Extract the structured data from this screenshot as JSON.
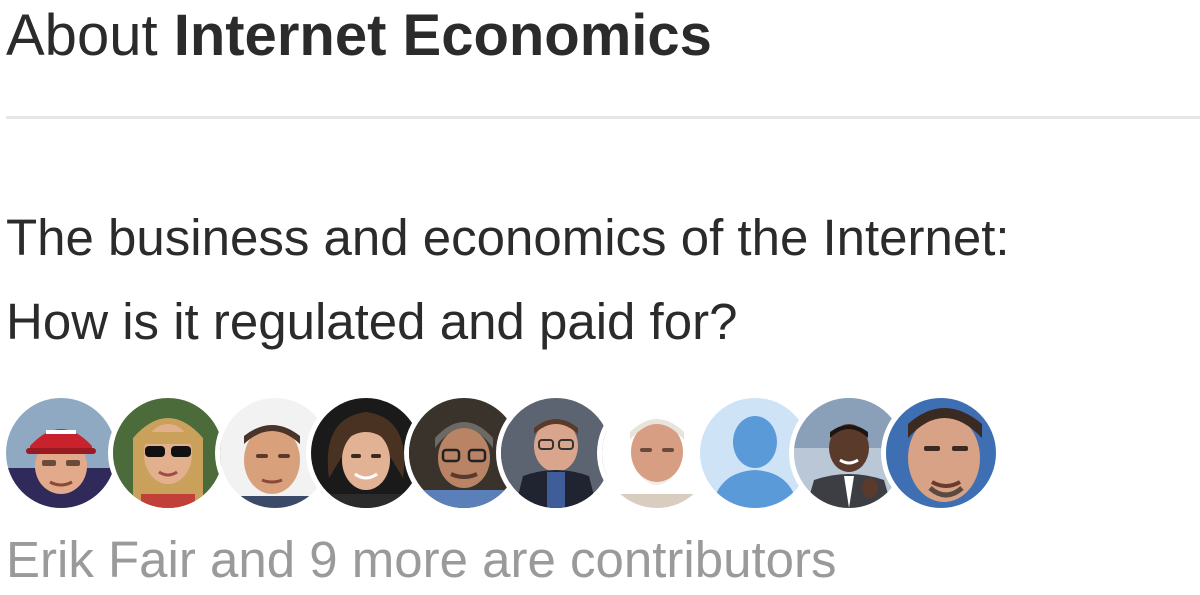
{
  "header": {
    "title_prefix": "About",
    "title_strong": "Internet Economics"
  },
  "description": {
    "line1": "The business and economics of the Internet:",
    "line2": "How is it regulated and paid for?"
  },
  "contributors": {
    "summary": "Erik Fair and 9 more are contributors",
    "avatars": [
      {
        "name": "contributor-avatar-1",
        "icon": "person-red-cap"
      },
      {
        "name": "contributor-avatar-2",
        "icon": "person-sunglasses"
      },
      {
        "name": "contributor-avatar-3",
        "icon": "person"
      },
      {
        "name": "contributor-avatar-4",
        "icon": "person-curly-hair"
      },
      {
        "name": "contributor-avatar-5",
        "icon": "person-glasses"
      },
      {
        "name": "contributor-avatar-6",
        "icon": "person-glasses"
      },
      {
        "name": "contributor-avatar-7",
        "icon": "person-white-beard"
      },
      {
        "name": "contributor-avatar-8",
        "icon": "default-user-silhouette-icon"
      },
      {
        "name": "contributor-avatar-9",
        "icon": "person-suit"
      },
      {
        "name": "contributor-avatar-10",
        "icon": "person"
      }
    ]
  },
  "colors": {
    "text": "#2b2b2b",
    "muted_text": "#9a9a9a",
    "divider": "#e6e6e6",
    "default_avatar_bg": "#cfe3f7",
    "default_avatar_fg": "#5b9ad9"
  }
}
